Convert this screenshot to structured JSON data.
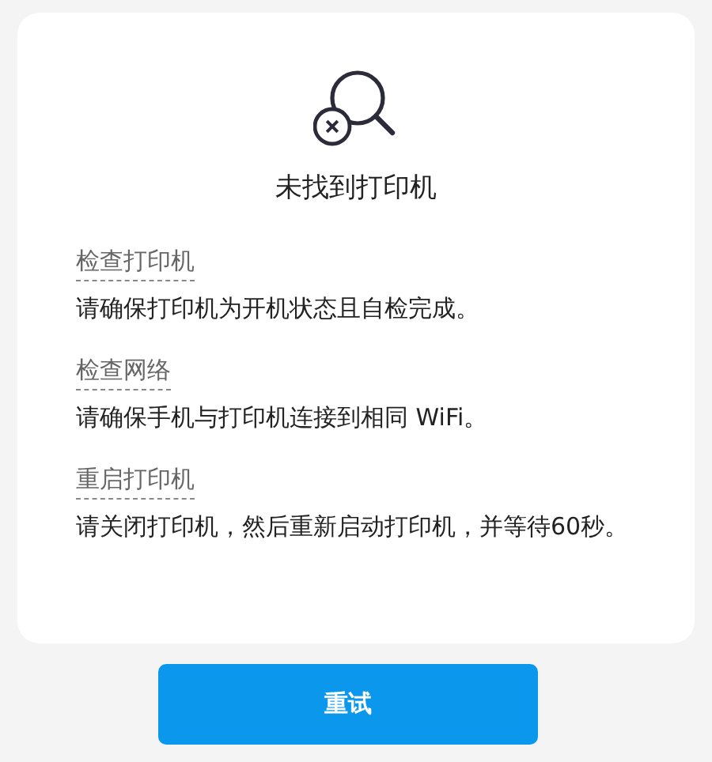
{
  "title": "未找到打印机",
  "checks": [
    {
      "heading": "检查打印机",
      "text": "请确保打印机为开机状态且自检完成。"
    },
    {
      "heading": "检查网络",
      "text": "请确保手机与打印机连接到相同 WiFi。"
    },
    {
      "heading": "重启打印机",
      "text": "请关闭打印机，然后重新启动打印机，并等待60秒。"
    }
  ],
  "button": "重试"
}
